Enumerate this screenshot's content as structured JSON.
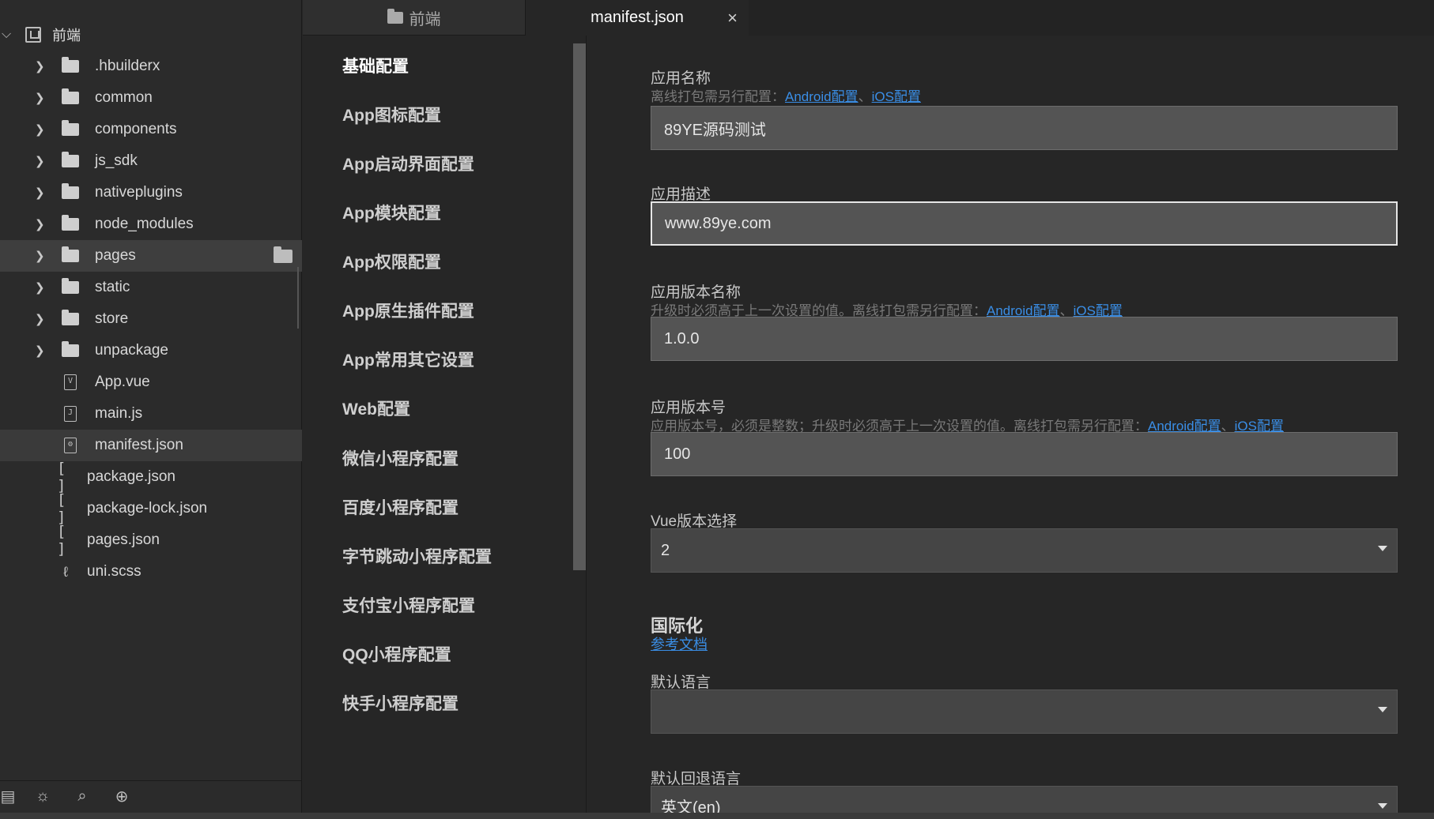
{
  "sidebar": {
    "root": {
      "label": "前端"
    },
    "items": [
      {
        "label": ".hbuilderx",
        "type": "folder"
      },
      {
        "label": "common",
        "type": "folder"
      },
      {
        "label": "components",
        "type": "folder"
      },
      {
        "label": "js_sdk",
        "type": "folder"
      },
      {
        "label": "nativeplugins",
        "type": "folder"
      },
      {
        "label": "node_modules",
        "type": "folder"
      },
      {
        "label": "pages",
        "type": "folder",
        "state": "selected"
      },
      {
        "label": "static",
        "type": "folder"
      },
      {
        "label": "store",
        "type": "folder"
      },
      {
        "label": "unpackage",
        "type": "folder"
      },
      {
        "label": "App.vue",
        "type": "vue-file",
        "icon_text": "V"
      },
      {
        "label": "main.js",
        "type": "js-file",
        "icon_text": "J"
      },
      {
        "label": "manifest.json",
        "type": "manifest-file",
        "state": "active",
        "icon_text": "⚙"
      },
      {
        "label": "package.json",
        "type": "json-file",
        "icon_text": "[ ]"
      },
      {
        "label": "package-lock.json",
        "type": "json-file",
        "icon_text": "[ ]"
      },
      {
        "label": "pages.json",
        "type": "json-file",
        "icon_text": "[ ]"
      },
      {
        "label": "uni.scss",
        "type": "scss-file",
        "icon_text": "ℓ"
      }
    ],
    "footer_icons": [
      "list-icon",
      "bug-icon",
      "search-log-icon",
      "globe-icon"
    ]
  },
  "tabs": [
    {
      "label": "前端",
      "active": false
    },
    {
      "label": "manifest.json",
      "active": true,
      "close": "×"
    }
  ],
  "nav": {
    "items": [
      "基础配置",
      "App图标配置",
      "App启动界面配置",
      "App模块配置",
      "App权限配置",
      "App原生插件配置",
      "App常用其它设置",
      "Web配置",
      "微信小程序配置",
      "百度小程序配置",
      "字节跳动小程序配置",
      "支付宝小程序配置",
      "QQ小程序配置",
      "快手小程序配置"
    ]
  },
  "form": {
    "app_name": {
      "label": "应用名称",
      "hint": "离线打包需另行配置：",
      "link_android": "Android配置",
      "sep": "、",
      "link_ios": "iOS配置",
      "value": "89YE源码测试"
    },
    "app_desc": {
      "label": "应用描述",
      "value": "www.89ye.com"
    },
    "version_name": {
      "label": "应用版本名称",
      "hint": "升级时必须高于上一次设置的值。离线打包需另行配置：",
      "link_android": "Android配置",
      "sep": "、",
      "link_ios": "iOS配置",
      "value": "1.0.0"
    },
    "version_code": {
      "label": "应用版本号",
      "hint": "应用版本号，必须是整数；升级时必须高于上一次设置的值。离线打包需另行配置：",
      "link_android": "Android配置",
      "sep": "、",
      "link_ios": "iOS配置",
      "value": "100"
    },
    "vue_version": {
      "label": "Vue版本选择",
      "value": "2"
    },
    "i18n": {
      "title": "国际化",
      "doc_link": "参考文档",
      "default_lang_label": "默认语言",
      "default_lang_value": "",
      "fallback_lang_label": "默认回退语言",
      "fallback_lang_value": "英文(en)"
    }
  },
  "colors": {
    "link": "#3a8ee6",
    "input_bg": "#545454",
    "select_bg": "#454545",
    "panel_bg": "#262626"
  }
}
